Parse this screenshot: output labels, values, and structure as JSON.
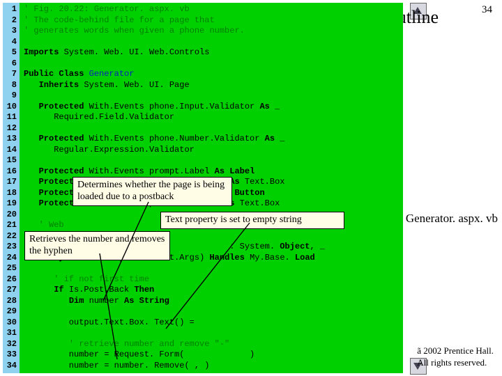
{
  "page_number": "34",
  "outline_title": "Outline",
  "right_label": "Generator. aspx. vb",
  "copyright_line1": "ã 2002 Prentice Hall.",
  "copyright_line2": "All rights reserved.",
  "gutter_start": 1,
  "gutter_end": 34,
  "callouts": {
    "c1": "Determines whether the page is being loaded due to a postback",
    "c2": "Text property is set to empty string",
    "c3": "Retrieves the number and removes the hyphen"
  },
  "code_lines": [
    {
      "t": "comm",
      "text": "' Fig. 20.22: Generator. aspx. vb"
    },
    {
      "t": "comm",
      "text": "' The code-behind file for a page that"
    },
    {
      "t": "comm",
      "text": "' generates words when given a phone number."
    },
    {
      "t": "blank",
      "text": ""
    },
    {
      "t": "mix",
      "html": "<span class=\"c-kw\">Imports</span> System. Web. UI. Web.Controls"
    },
    {
      "t": "blank",
      "text": ""
    },
    {
      "t": "mix",
      "html": "<span class=\"c-kw\">Public Class</span> <span class=\"c-blue\">Generator</span>"
    },
    {
      "t": "mix",
      "html": "   <span class=\"c-kw\">Inherits</span> System. Web. UI. Page"
    },
    {
      "t": "blank",
      "text": ""
    },
    {
      "t": "mix",
      "html": "   <span class=\"c-kw\">Protected</span> With.Events phone.Input.Validator <span class=\"c-kw\">As</span> _"
    },
    {
      "t": "mix",
      "html": "      Required.Field.Validator"
    },
    {
      "t": "blank",
      "text": ""
    },
    {
      "t": "mix",
      "html": "   <span class=\"c-kw\">Protected</span> With.Events phone.Number.Validator <span class=\"c-kw\">As</span> _"
    },
    {
      "t": "mix",
      "html": "      Regular.Expression.Validator"
    },
    {
      "t": "blank",
      "text": ""
    },
    {
      "t": "mix",
      "html": "   <span class=\"c-kw\">Protected</span> With.Events prompt.Label <span class=\"c-kw\">As</span> <span class=\"c-kw\">Label</span>"
    },
    {
      "t": "mix",
      "html": "   <span class=\"c-kw\">Protected</span> With.Events output.Text.Box <span class=\"c-kw\">As</span> Text.Box"
    },
    {
      "t": "mix",
      "html": "   <span class=\"c-kw\">Protected</span> With.Events submit.Button <span class=\"c-kw\">As</span> <span class=\"c-kw\">Button</span>"
    },
    {
      "t": "mix",
      "html": "   <span class=\"c-kw\">Protected</span> With.Events phone.Text.Box <span class=\"c-kw\">As</span> Text.Box"
    },
    {
      "t": "blank",
      "text": ""
    },
    {
      "t": "comm",
      "text": "   ' Web            "
    },
    {
      "t": "blank",
      "text": ""
    },
    {
      "t": "mix",
      "html": "   <span class=\"c-kw\">Private</span>                               : System. <span class=\"c-kw\">Object</span>, _"
    },
    {
      "t": "mix",
      "html": "      <span class=\"c-kw\">By.Val</span> e <span class=\"c-kw\">As</span> System.Event.Args) <span class=\"c-kw\">Handles</span> My.Base. <span class=\"c-kw\">Load</span>"
    },
    {
      "t": "blank",
      "text": ""
    },
    {
      "t": "comm",
      "text": "      ' if not first time"
    },
    {
      "t": "mix",
      "html": "      <span class=\"c-kw\">If</span> Is.Post.Back <span class=\"c-kw\">Then</span>"
    },
    {
      "t": "mix",
      "html": "         <span class=\"c-kw\">Dim</span> number <span class=\"c-kw\">As String</span>"
    },
    {
      "t": "blank",
      "text": ""
    },
    {
      "t": "mix",
      "html": "         output.Text.Box. Text() ="
    },
    {
      "t": "blank",
      "text": ""
    },
    {
      "t": "comm",
      "text": "         ' retrieve number and remove \"-\""
    },
    {
      "t": "mix",
      "html": "         number = Request. Form(             )"
    },
    {
      "t": "mix",
      "html": "         number = number. Remove( , )"
    }
  ]
}
